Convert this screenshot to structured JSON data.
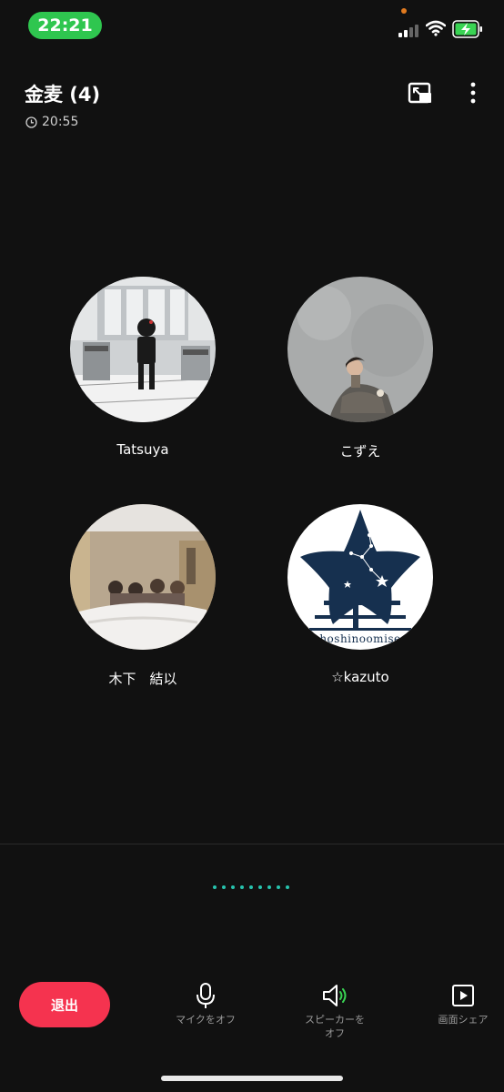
{
  "status_bar": {
    "time": "22:21",
    "colors": {
      "time_pill": "#2fc64f",
      "privacy_dot": "#e07a1f",
      "battery_fill": "#39d353"
    },
    "icons": [
      "signal-icon",
      "wifi-icon",
      "battery-charging-icon"
    ]
  },
  "header": {
    "title": "金麦 (4)",
    "duration": "20:55",
    "icons": [
      "clock-icon",
      "picture-in-picture-icon",
      "more-vertical-icon"
    ]
  },
  "participants": [
    {
      "name": "Tatsuya"
    },
    {
      "name": "こずえ"
    },
    {
      "name": "木下　結以"
    },
    {
      "name": "☆kazuto",
      "avatar_text": "hoshinoomise"
    }
  ],
  "pager": {
    "dot_count": 9,
    "color": "#27c3ae"
  },
  "controls": {
    "leave": "退出",
    "mic": "マイクをオフ",
    "speaker": "スピーカーを\nオフ",
    "share": "画面シェア",
    "accent": "#f5334f",
    "speaker_active_color": "#39d353"
  }
}
